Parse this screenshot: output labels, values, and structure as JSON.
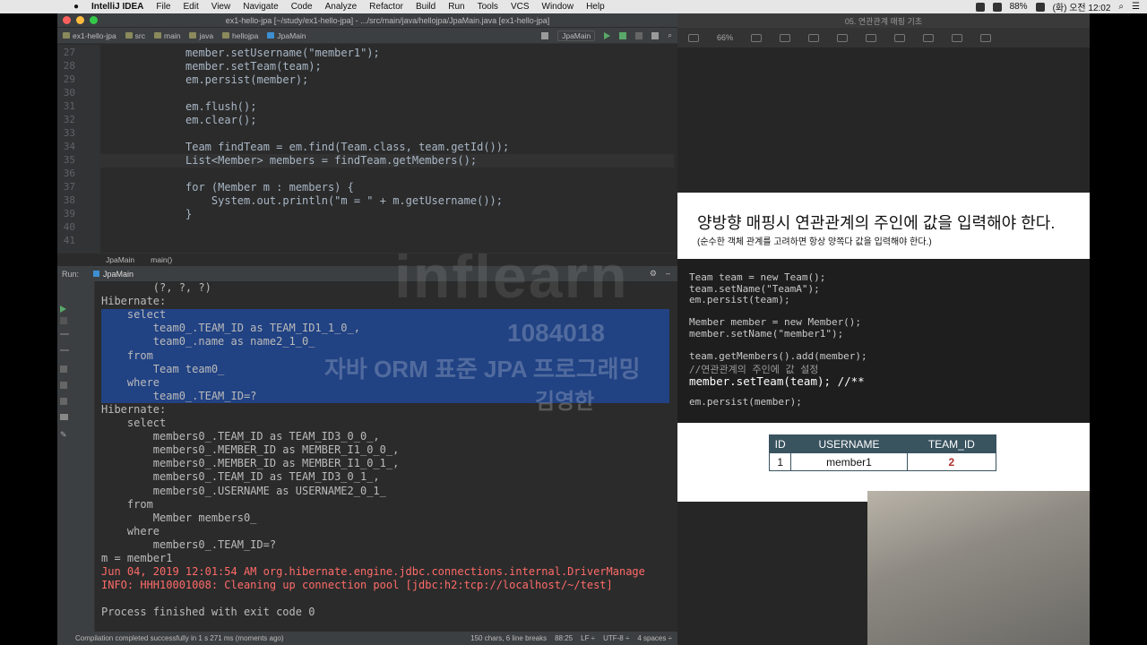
{
  "menubar": {
    "app": "IntelliJ IDEA",
    "items": [
      "File",
      "Edit",
      "View",
      "Navigate",
      "Code",
      "Analyze",
      "Refactor",
      "Build",
      "Run",
      "Tools",
      "VCS",
      "Window",
      "Help"
    ],
    "battery": "88%",
    "clock": "(화) 오전 12:02"
  },
  "ide": {
    "window_title": "ex1-hello-jpa [~/study/ex1-hello-jpa] - .../src/main/java/hellojpa/JpaMain.java [ex1-hello-jpa]",
    "breadcrumbs": [
      "ex1-hello-jpa",
      "src",
      "main",
      "java",
      "hellojpa",
      "JpaMain"
    ],
    "run_config": "JpaMain",
    "code_lines": [
      {
        "n": "27",
        "text": "member.setUsername(\"member1\");",
        "indent": 0
      },
      {
        "n": "28",
        "text": "member.setTeam(team);",
        "indent": 0
      },
      {
        "n": "29",
        "text": "em.persist(member);",
        "indent": 0
      },
      {
        "n": "30",
        "text": "",
        "indent": 0
      },
      {
        "n": "31",
        "text": "em.flush();",
        "indent": 0
      },
      {
        "n": "32",
        "text": "em.clear();",
        "indent": 0
      },
      {
        "n": "33",
        "text": "",
        "indent": 0
      },
      {
        "n": "34",
        "text": "Team findTeam = em.find(Team.class, team.getId());",
        "indent": 0
      },
      {
        "n": "35",
        "text": "List<Member> members = findTeam.getMembers();",
        "indent": 0
      },
      {
        "n": "36",
        "text": "",
        "indent": 0
      },
      {
        "n": "37",
        "text": "for (Member m : members) {",
        "indent": 0
      },
      {
        "n": "38",
        "text": "    System.out.println(\"m = \" + m.getUsername());",
        "indent": 0
      },
      {
        "n": "39",
        "text": "}",
        "indent": 0
      },
      {
        "n": "40",
        "text": "",
        "indent": 0
      },
      {
        "n": "41",
        "text": "",
        "indent": 0
      }
    ],
    "bottom_crumbs": [
      "JpaMain",
      "main()"
    ],
    "run_label": "Run:",
    "run_tab": "JpaMain",
    "console": [
      "        (?, ?, ?)",
      "Hibernate: ",
      "    select",
      "        team0_.TEAM_ID as TEAM_ID1_1_0_,",
      "        team0_.name as name2_1_0_ ",
      "    from",
      "        Team team0_ ",
      "    where",
      "        team0_.TEAM_ID=?",
      "Hibernate: ",
      "    select",
      "        members0_.TEAM_ID as TEAM_ID3_0_0_,",
      "        members0_.MEMBER_ID as MEMBER_I1_0_0_,",
      "        members0_.MEMBER_ID as MEMBER_I1_0_1_,",
      "        members0_.TEAM_ID as TEAM_ID3_0_1_,",
      "        members0_.USERNAME as USERNAME2_0_1_ ",
      "    from",
      "        Member members0_ ",
      "    where",
      "        members0_.TEAM_ID=?",
      "m = member1",
      "Jun 04, 2019 12:01:54 AM org.hibernate.engine.jdbc.connections.internal.DriverManage",
      "INFO: HHH10001008: Cleaning up connection pool [jdbc:h2:tcp://localhost/~/test]",
      "",
      "Process finished with exit code 0"
    ],
    "status_left": "Compilation completed successfully in 1 s 271 ms (moments ago)",
    "status_right": [
      "150 chars, 6 line breaks",
      "88:25",
      "LF ÷",
      "UTF-8 ÷",
      "4 spaces ÷"
    ]
  },
  "keynote": {
    "window_title": "05. 연관관계 매핑 기초",
    "zoom": "66%",
    "slide_title": "양방향 매핑시 연관관계의 주인에 값을 입력해야 한다.",
    "slide_subtitle": "(순수한 객체 관계를 고려하면 항상 양쪽다 값을 입력해야 한다.)",
    "slide_code": [
      "Team team = new Team();",
      "team.setName(\"TeamA\");",
      "em.persist(team);",
      "",
      "Member member = new Member();",
      "member.setName(\"member1\");",
      "",
      "team.getMembers().add(member);",
      "//연관관계의 주인에 값 설정",
      "member.setTeam(team); //**",
      "",
      "em.persist(member);"
    ],
    "table_headers": [
      "ID",
      "USERNAME",
      "TEAM_ID"
    ],
    "table_row": [
      "1",
      "member1",
      "2"
    ]
  },
  "watermark": {
    "brand": "inflearn",
    "id": "1084018",
    "course": "자바 ORM 표준 JPA 프로그래밍",
    "name": "김영한"
  },
  "colors": {
    "selection": "#214283",
    "error": "#ff6b68",
    "keyword": "#cc7832",
    "string": "#6a8759",
    "table_header": "#39535f"
  }
}
